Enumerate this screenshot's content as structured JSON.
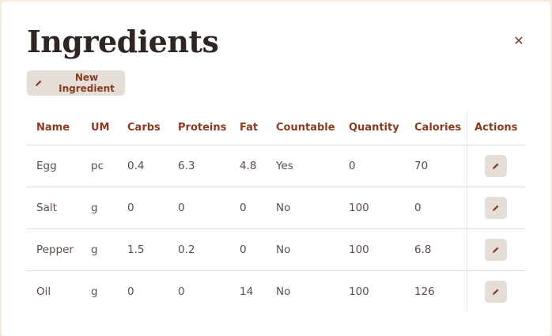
{
  "page": {
    "title": "Ingredients"
  },
  "close_icon": "close-icon",
  "toolbar": {
    "new_label": "New Ingredient",
    "new_icon": "pencil-icon"
  },
  "table": {
    "headers": [
      "Name",
      "UM",
      "Carbs",
      "Proteins",
      "Fat",
      "Countable",
      "Quantity",
      "Calories",
      "Actions"
    ],
    "rows": [
      [
        "Egg",
        "pc",
        "0.4",
        "6.3",
        "4.8",
        "Yes",
        "0",
        "70"
      ],
      [
        "Salt",
        "g",
        "0",
        "0",
        "0",
        "No",
        "100",
        "0"
      ],
      [
        "Pepper",
        "g",
        "1.5",
        "0.2",
        "0",
        "No",
        "100",
        "6.8"
      ],
      [
        "Oil",
        "g",
        "0",
        "0",
        "14",
        "No",
        "100",
        "126"
      ]
    ],
    "row_action_icon": "pencil-icon"
  },
  "colors": {
    "accent": "#8a3a22",
    "button_bg": "#e5ded7",
    "title": "#2f2523",
    "background": "#f6e9dd"
  }
}
